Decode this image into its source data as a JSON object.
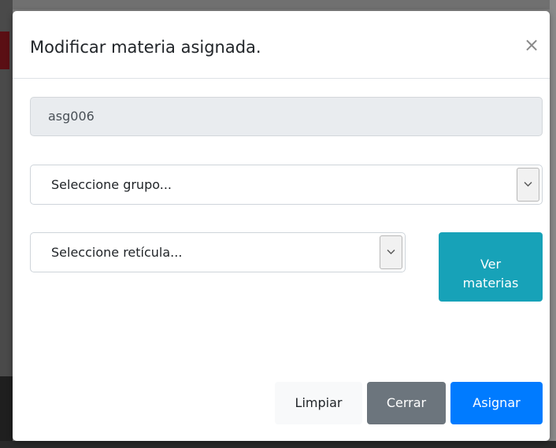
{
  "modal": {
    "title": "Modificar materia asignada.",
    "close_glyph": "×",
    "close_icon": "close-icon"
  },
  "form": {
    "id_value": "asg006",
    "grupo_select": {
      "selected": "Seleccione grupo...",
      "icon": "chevron-down-icon"
    },
    "reticula_select": {
      "selected": "Seleccione retícula...",
      "icon": "chevron-down-icon"
    },
    "ver_materias_button": {
      "line1": "Ver",
      "line2": "materias"
    }
  },
  "footer": {
    "limpiar_label": "Limpiar",
    "cerrar_label": "Cerrar",
    "asignar_label": "Asignar"
  },
  "colors": {
    "info": "#17a2b8",
    "secondary": "#6c757d",
    "primary": "#007bff",
    "light": "#f8f9fa",
    "readonly_bg": "#e9ecef"
  }
}
